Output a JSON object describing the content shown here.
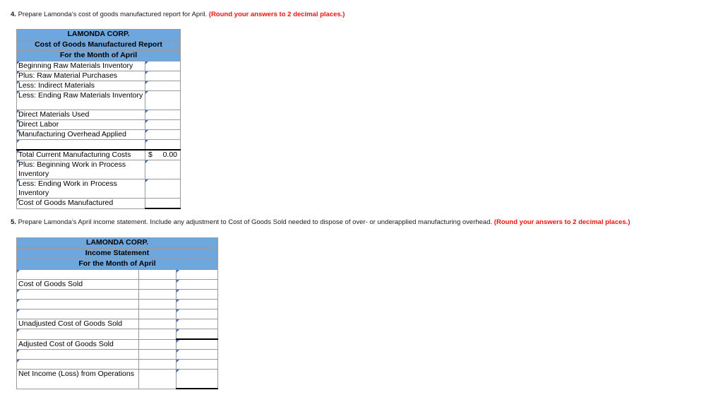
{
  "questions": {
    "q4": {
      "number": "4.",
      "text": "Prepare Lamonda’s cost of goods manufactured report for April.",
      "note": "(Round your answers to 2 decimal places.)"
    },
    "q5": {
      "number": "5.",
      "text": "Prepare Lamonda’s April income statement. Include any adjustment to Cost of Goods Sold needed to dispose of over- or underapplied manufacturing overhead.",
      "note": "(Round your answers to 2 decimal places.)"
    }
  },
  "colors": {
    "header_blue": "#6ea7dd",
    "grid_gray": "#9a9a9a",
    "note_red": "#ee1111",
    "comment_tick_blue": "#3d6fb4"
  },
  "cogm_table": {
    "title_lines": [
      "LAMONDA CORP.",
      "Cost of Goods Manufactured Report",
      "For the Month of April"
    ],
    "rows": [
      {
        "label": "Beginning Raw Materials Inventory",
        "indent": 1,
        "value": "",
        "wrap": false
      },
      {
        "label": "Plus: Raw Material Purchases",
        "indent": 2,
        "value": "",
        "wrap": false
      },
      {
        "label": "Less: Indirect Materials",
        "indent": 2,
        "value": "",
        "wrap": false
      },
      {
        "label": "Less: Ending Raw Materials Inventory",
        "indent": 2,
        "value": "",
        "wrap": true
      },
      {
        "label": "Direct Materials Used",
        "indent": 1,
        "value": "",
        "wrap": false
      },
      {
        "label": "Direct Labor",
        "indent": 1,
        "value": "",
        "wrap": false
      },
      {
        "label": "Manufacturing Overhead Applied",
        "indent": 1,
        "value": "",
        "wrap": false
      },
      {
        "label": "",
        "indent": 1,
        "value": "",
        "wrap": false
      },
      {
        "label": "Total Current Manufacturing Costs",
        "indent": 1,
        "value": "0.00",
        "currency": "$",
        "wrap": false,
        "rule_top": true
      },
      {
        "label": "Plus: Beginning Work in Process Inventory",
        "indent": 2,
        "value": "",
        "wrap": true
      },
      {
        "label": "Less: Ending Work in Process Inventory",
        "indent": 2,
        "value": "",
        "wrap": true
      },
      {
        "label": "Cost of Goods Manufactured",
        "indent": 2,
        "value": "",
        "wrap": false,
        "rule_bottom": true
      }
    ]
  },
  "income_statement_table": {
    "title_lines": [
      "LAMONDA CORP.",
      "Income Statement",
      "For the Month of April"
    ],
    "rows": [
      {
        "label": "",
        "indent": 1,
        "v1": "",
        "v2": "",
        "wrap": false
      },
      {
        "label": "Cost of Goods Sold",
        "indent": 1,
        "v1": "",
        "v2": "",
        "wrap": false
      },
      {
        "label": "",
        "indent": 1,
        "v1": "",
        "v2": "",
        "wrap": false
      },
      {
        "label": "",
        "indent": 1,
        "v1": "",
        "v2": "",
        "wrap": false
      },
      {
        "label": "",
        "indent": 1,
        "v1": "",
        "v2": "",
        "wrap": false
      },
      {
        "label": "Unadjusted Cost of Goods Sold",
        "indent": 2,
        "v1": "",
        "v2": "",
        "wrap": false
      },
      {
        "label": "",
        "indent": 1,
        "v1": "",
        "v2": "",
        "wrap": false
      },
      {
        "label": "Adjusted Cost of Goods Sold",
        "indent": 1,
        "v1": "",
        "v2": "",
        "wrap": false,
        "rule_top_v2": true
      },
      {
        "label": "",
        "indent": 1,
        "v1": "",
        "v2": "",
        "wrap": false
      },
      {
        "label": "",
        "indent": 1,
        "v1": "",
        "v2": "",
        "wrap": false
      },
      {
        "label": "Net Income (Loss) from Operations",
        "indent": 2,
        "v1": "",
        "v2": "",
        "wrap": true,
        "rule_bottom_v2": true
      }
    ]
  }
}
